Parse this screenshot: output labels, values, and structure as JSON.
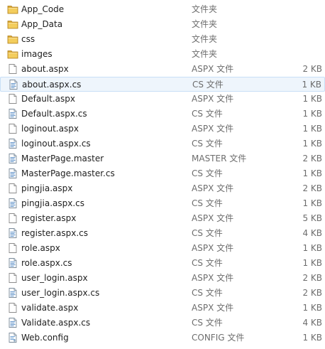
{
  "files": [
    {
      "name": "App_Code",
      "type": "文件夹",
      "size": "",
      "icon": "folder-icon"
    },
    {
      "name": "App_Data",
      "type": "文件夹",
      "size": "",
      "icon": "folder-icon"
    },
    {
      "name": "css",
      "type": "文件夹",
      "size": "",
      "icon": "folder-icon"
    },
    {
      "name": "images",
      "type": "文件夹",
      "size": "",
      "icon": "folder-icon"
    },
    {
      "name": "about.aspx",
      "type": "ASPX 文件",
      "size": "2 KB",
      "icon": "document-icon"
    },
    {
      "name": "about.aspx.cs",
      "type": "CS 文件",
      "size": "1 KB",
      "icon": "code-file-icon",
      "selected": true
    },
    {
      "name": "Default.aspx",
      "type": "ASPX 文件",
      "size": "1 KB",
      "icon": "document-icon"
    },
    {
      "name": "Default.aspx.cs",
      "type": "CS 文件",
      "size": "1 KB",
      "icon": "code-file-icon"
    },
    {
      "name": "loginout.aspx",
      "type": "ASPX 文件",
      "size": "1 KB",
      "icon": "document-icon"
    },
    {
      "name": "loginout.aspx.cs",
      "type": "CS 文件",
      "size": "1 KB",
      "icon": "code-file-icon"
    },
    {
      "name": "MasterPage.master",
      "type": "MASTER 文件",
      "size": "2 KB",
      "icon": "code-file-icon"
    },
    {
      "name": "MasterPage.master.cs",
      "type": "CS 文件",
      "size": "1 KB",
      "icon": "code-file-icon"
    },
    {
      "name": "pingjia.aspx",
      "type": "ASPX 文件",
      "size": "2 KB",
      "icon": "document-icon"
    },
    {
      "name": "pingjia.aspx.cs",
      "type": "CS 文件",
      "size": "1 KB",
      "icon": "code-file-icon"
    },
    {
      "name": "register.aspx",
      "type": "ASPX 文件",
      "size": "5 KB",
      "icon": "document-icon"
    },
    {
      "name": "register.aspx.cs",
      "type": "CS 文件",
      "size": "4 KB",
      "icon": "code-file-icon"
    },
    {
      "name": "role.aspx",
      "type": "ASPX 文件",
      "size": "1 KB",
      "icon": "document-icon"
    },
    {
      "name": "role.aspx.cs",
      "type": "CS 文件",
      "size": "1 KB",
      "icon": "code-file-icon"
    },
    {
      "name": "user_login.aspx",
      "type": "ASPX 文件",
      "size": "2 KB",
      "icon": "document-icon"
    },
    {
      "name": "user_login.aspx.cs",
      "type": "CS 文件",
      "size": "2 KB",
      "icon": "code-file-icon"
    },
    {
      "name": "validate.aspx",
      "type": "ASPX 文件",
      "size": "1 KB",
      "icon": "document-icon"
    },
    {
      "name": "Validate.aspx.cs",
      "type": "CS 文件",
      "size": "4 KB",
      "icon": "code-file-icon"
    },
    {
      "name": "Web.config",
      "type": "CONFIG 文件",
      "size": "1 KB",
      "icon": "config-file-icon"
    }
  ]
}
